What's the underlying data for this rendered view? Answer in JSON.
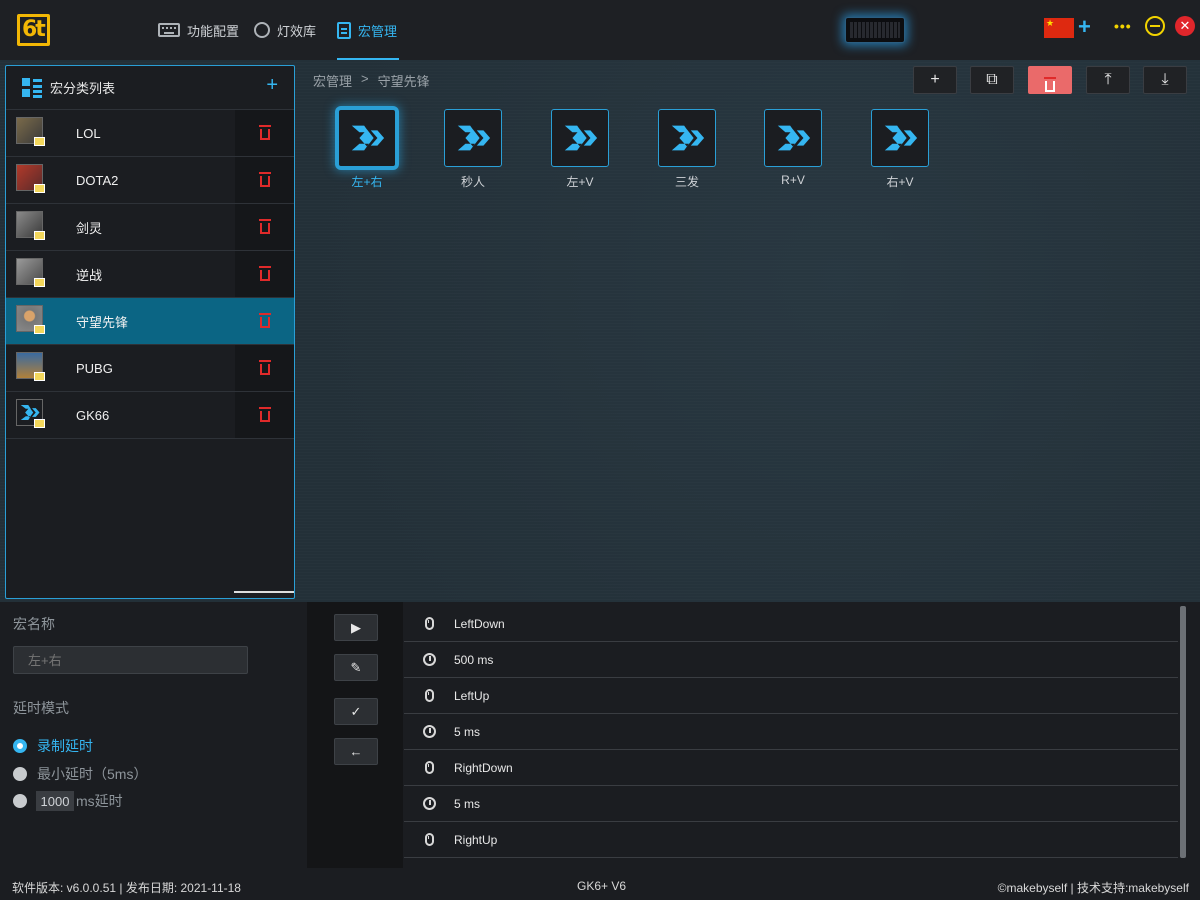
{
  "app": {
    "logo_text": "6t"
  },
  "nav": [
    {
      "label": "功能配置",
      "icon": "keyboard-icon",
      "active": false
    },
    {
      "label": "灯效库",
      "icon": "bulb-icon",
      "active": false
    },
    {
      "label": "宏管理",
      "icon": "document-icon",
      "active": true
    }
  ],
  "topright": {
    "language_flag": "china-flag-icon",
    "add": "+",
    "more": "•••",
    "close": "✕"
  },
  "categories": {
    "title": "宏分类列表",
    "add": "+",
    "items": [
      {
        "name": "LOL",
        "selected": false
      },
      {
        "name": "DOTA2",
        "selected": false
      },
      {
        "name": "剑灵",
        "selected": false
      },
      {
        "name": "逆战",
        "selected": false
      },
      {
        "name": "守望先锋",
        "selected": true
      },
      {
        "name": "PUBG",
        "selected": false
      },
      {
        "name": "GK66",
        "selected": false
      }
    ]
  },
  "breadcrumb": {
    "root": "宏管理",
    "sep": ">",
    "current": "守望先锋"
  },
  "toolbar": {
    "add": "+",
    "copy": "⧉",
    "delete": "trash",
    "upload": "⤒",
    "download": "⤓"
  },
  "macros": [
    {
      "label": "左+右",
      "selected": true
    },
    {
      "label": "秒人",
      "selected": false
    },
    {
      "label": "左+V",
      "selected": false
    },
    {
      "label": "三发",
      "selected": false
    },
    {
      "label": "R+V",
      "selected": false
    },
    {
      "label": "右+V",
      "selected": false
    }
  ],
  "editor": {
    "name_label": "宏名称",
    "name_placeholder": "左+右",
    "delay_label": "延时模式",
    "delay_options": [
      "录制延时",
      "最小延时（5ms）",
      "ms延时"
    ],
    "delay_selected": 0,
    "custom_ms": "1000"
  },
  "commands": {
    "play": "▶",
    "edit": "✎",
    "confirm": "✓",
    "back": "←"
  },
  "steps": [
    {
      "icon": "mouse-icon",
      "text": "LeftDown"
    },
    {
      "icon": "clock-icon",
      "text": "500 ms"
    },
    {
      "icon": "mouse-icon",
      "text": "LeftUp"
    },
    {
      "icon": "clock-icon",
      "text": "5 ms"
    },
    {
      "icon": "mouse-icon",
      "text": "RightDown"
    },
    {
      "icon": "clock-icon",
      "text": "5 ms"
    },
    {
      "icon": "mouse-icon",
      "text": "RightUp"
    }
  ],
  "status": {
    "left": "软件版本: v6.0.0.51 | 发布日期: 2021-11-18",
    "center": "GK6+ V6",
    "right": "©makebyself | 技术支持:makebyself"
  },
  "colors": {
    "accent": "#35b6f1",
    "danger": "#e02a2a",
    "selected_row": "#0b6584"
  }
}
